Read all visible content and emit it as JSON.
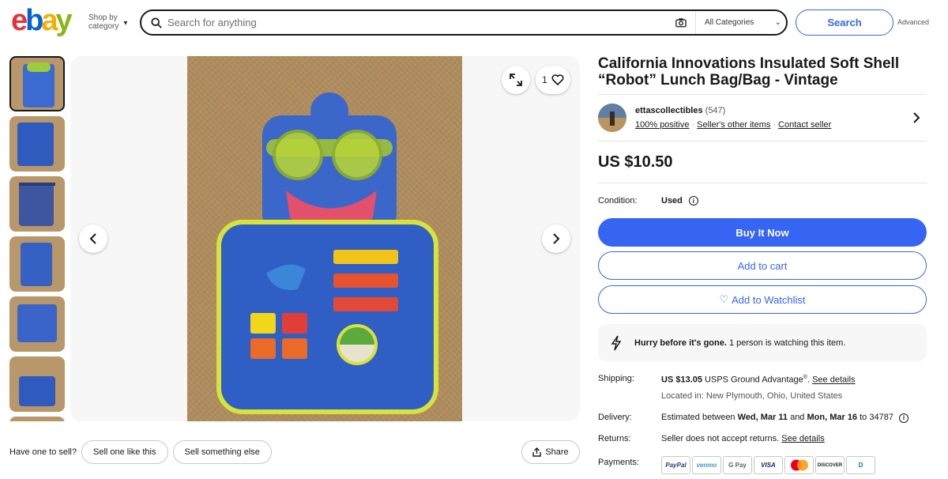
{
  "header": {
    "logo_text": "ebay",
    "shop_by_line1": "Shop by",
    "shop_by_line2": "category",
    "search_placeholder": "Search for anything",
    "category": "All Categories",
    "search_label": "Search",
    "advanced_label": "Advanced"
  },
  "gallery": {
    "watch_count": "1",
    "thumbnails": 7
  },
  "below_image": {
    "prompt": "Have one to sell?",
    "sell_like": "Sell one like this",
    "sell_else": "Sell something else",
    "share": "Share"
  },
  "listing": {
    "title": "California Innovations Insulated Soft Shell “Robot” Lunch Bag/Bag - Vintage",
    "seller_name": "ettascollectibles",
    "seller_score": "(547)",
    "positive": "100% positive",
    "other_items": "Seller's other items",
    "contact": "Contact seller",
    "price": "US $10.50",
    "condition_label": "Condition:",
    "condition_value": "Used",
    "buy_now": "Buy It Now",
    "add_cart": "Add to cart",
    "add_watchlist": "Add to Watchlist",
    "hurry_bold": "Hurry before it's gone.",
    "hurry_rest": " 1 person is watching this item."
  },
  "shipping": {
    "label": "Shipping:",
    "cost": "US $13.05",
    "service": " USPS Ground Advantage",
    "reg": "®",
    "period": ".",
    "see_details": "See details",
    "location": "Located in: New Plymouth, Ohio, United States"
  },
  "delivery": {
    "label": "Delivery:",
    "prefix": "Estimated between ",
    "start": "Wed, Mar 11",
    "and": " and ",
    "end": "Mon, Mar 16",
    "to": " to 34787"
  },
  "returns": {
    "label": "Returns:",
    "text": "Seller does not accept returns.",
    "see_details": "See details"
  },
  "payments": {
    "label": "Payments:",
    "methods": [
      "PayPal",
      "venmo",
      "G Pay",
      "VISA",
      "",
      "DISCOVER",
      "D"
    ]
  },
  "colors": {
    "primary": "#3665f3",
    "text": "#191919"
  }
}
